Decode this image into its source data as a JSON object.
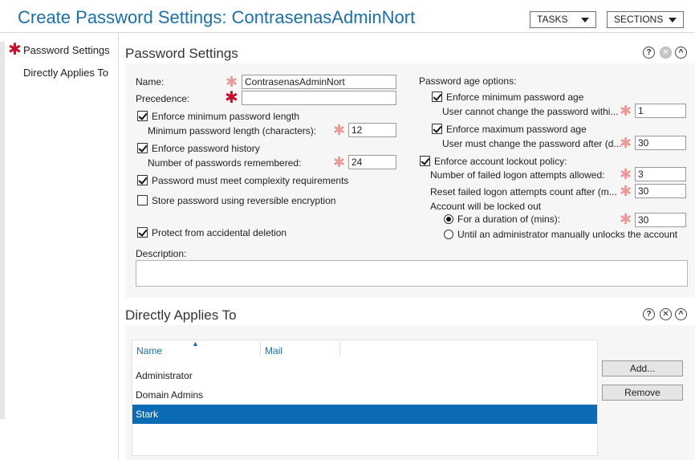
{
  "header": {
    "title": "Create Password Settings: ContrasenasAdminNort",
    "tasks_label": "TASKS",
    "sections_label": "SECTIONS"
  },
  "nav": {
    "items": [
      {
        "label": "Password Settings",
        "required": true
      },
      {
        "label": "Directly Applies To",
        "required": false
      }
    ]
  },
  "password_settings": {
    "title": "Password Settings",
    "name_label": "Name:",
    "name_value": "ContrasenasAdminNort",
    "precedence_label": "Precedence:",
    "precedence_value": "",
    "enforce_min_length_label": "Enforce minimum password length",
    "enforce_min_length_checked": true,
    "min_length_label": "Minimum password length (characters):",
    "min_length_value": "12",
    "enforce_history_label": "Enforce password history",
    "enforce_history_checked": true,
    "history_count_label": "Number of passwords remembered:",
    "history_count_value": "24",
    "complexity_label": "Password must meet complexity requirements",
    "complexity_checked": true,
    "reversible_label": "Store password using reversible encryption",
    "reversible_checked": false,
    "protect_label": "Protect from accidental deletion",
    "protect_checked": true,
    "description_label": "Description:",
    "description_value": "",
    "age_options_label": "Password age options:",
    "enforce_min_age_label": "Enforce minimum password age",
    "enforce_min_age_checked": true,
    "min_age_label": "User cannot change the password withi...",
    "min_age_value": "1",
    "enforce_max_age_label": "Enforce maximum password age",
    "enforce_max_age_checked": true,
    "max_age_label": "User must change the password after (d...",
    "max_age_value": "30",
    "lockout_policy_label": "Enforce account lockout policy:",
    "lockout_policy_checked": true,
    "failed_attempts_label": "Number of failed logon attempts allowed:",
    "failed_attempts_value": "3",
    "reset_count_label": "Reset failed logon attempts count after (m...",
    "reset_count_value": "30",
    "locked_out_label": "Account will be locked out",
    "duration_label": "For a duration of (mins):",
    "duration_selected": true,
    "duration_value": "30",
    "until_admin_label": "Until an administrator manually unlocks the account",
    "until_admin_selected": false
  },
  "applies_to": {
    "title": "Directly Applies To",
    "columns": [
      "Name",
      "Mail"
    ],
    "rows": [
      {
        "name": "Administrator",
        "mail": "",
        "selected": false
      },
      {
        "name": "Domain Admins",
        "mail": "",
        "selected": false
      },
      {
        "name": "Stark",
        "mail": "",
        "selected": true
      }
    ],
    "add_label": "Add...",
    "remove_label": "Remove"
  },
  "icons": {
    "help": "?",
    "close": "✕",
    "collapse": "^"
  },
  "colors": {
    "title": "#1d6fa5",
    "required_star": "#c8102e",
    "selection": "#0c6bb5"
  }
}
